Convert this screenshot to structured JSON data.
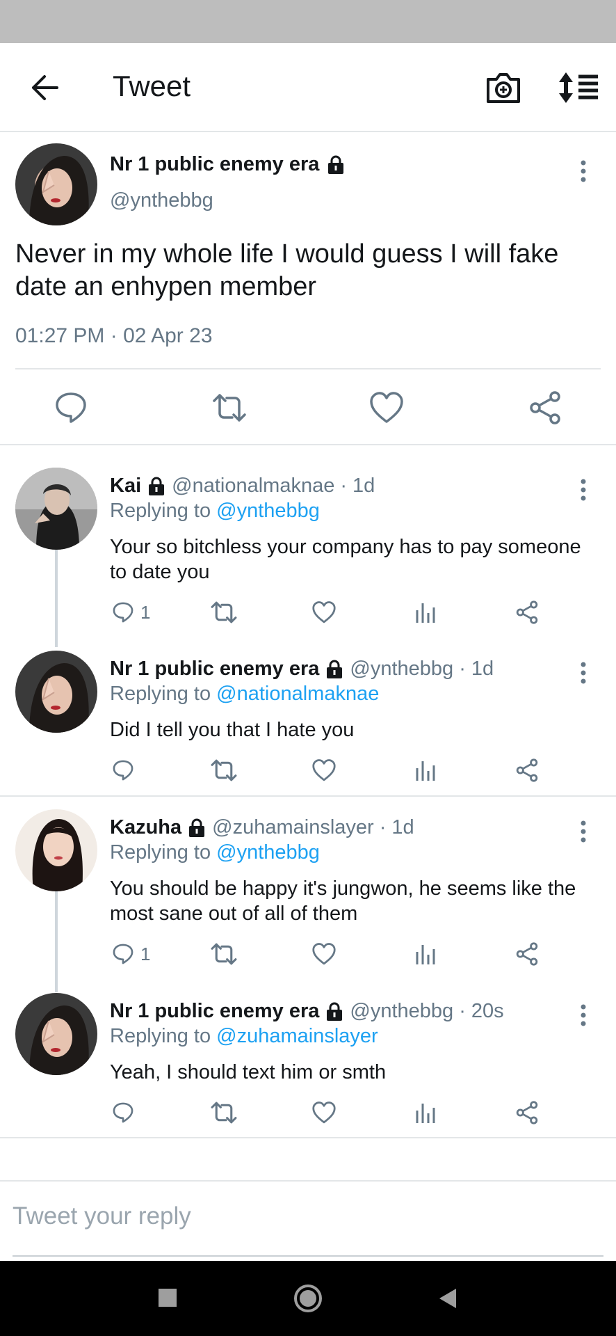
{
  "app_bar": {
    "title": "Tweet",
    "back_icon": "arrow-left-icon",
    "camera_icon": "camera-plus-icon",
    "sort_icon": "sort-icon"
  },
  "main_tweet": {
    "name": "Nr 1 public enemy era",
    "handle": "@ynthebbg",
    "text": "Never in my whole life I would guess I will fake date an enhypen member",
    "timestamp": "01:27 PM · 02 Apr 23",
    "protected_icon": "lock-icon"
  },
  "replies": [
    {
      "name": "Kai",
      "handle": "@nationalmaknae",
      "time": "· 1d",
      "replying_label": "Replying to",
      "replying_to": "@ynthebbg",
      "text": "Your so bitchless your company has to pay someone to date you",
      "reply_count": "1"
    },
    {
      "name": "Nr 1 public enemy era",
      "handle": "@ynthebbg",
      "time": "· 1d",
      "replying_label": "Replying to",
      "replying_to": "@nationalmaknae",
      "text": "Did I tell you that I hate you",
      "reply_count": ""
    },
    {
      "name": "Kazuha",
      "handle": "@zuhamainslayer",
      "time": "· 1d",
      "replying_label": "Replying to",
      "replying_to": "@ynthebbg",
      "text": "You should be happy it's jungwon, he seems like the most sane out of all of them",
      "reply_count": "1"
    },
    {
      "name": "Nr 1 public enemy era",
      "handle": "@ynthebbg",
      "time": "· 20s",
      "replying_label": "Replying to",
      "replying_to": "@zuhamainslayer",
      "text": "Yeah, I should text him or smth",
      "reply_count": ""
    }
  ],
  "reply_box": {
    "placeholder": "Tweet your reply"
  },
  "colors": {
    "link": "#1da1f2",
    "secondary_text": "#657786",
    "primary_text": "#14171a",
    "divider": "#e3e6e8"
  }
}
